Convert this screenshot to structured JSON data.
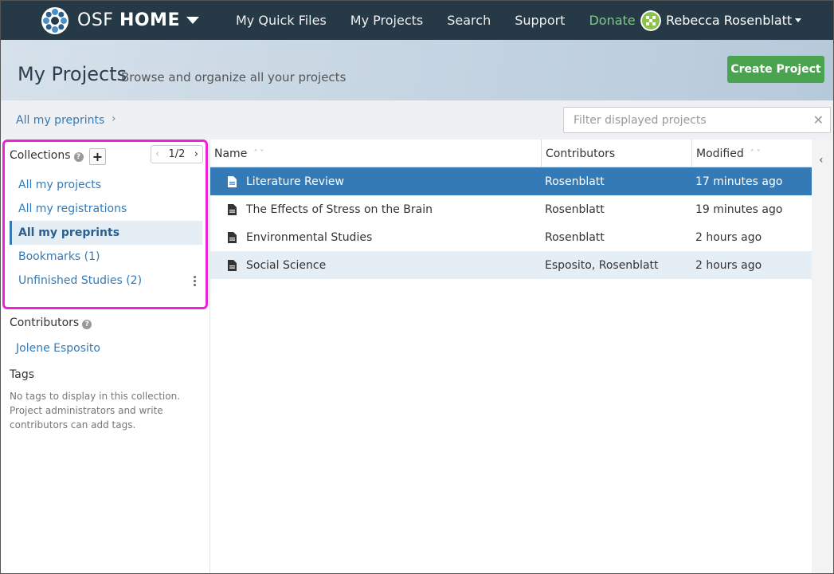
{
  "colors": {
    "navbar": "#263947",
    "accent": "#337ab7",
    "create": "#4aa34f",
    "highlight": "#ee22d6",
    "donate": "#7ec884"
  },
  "navbar": {
    "brand_prefix": "OSF",
    "brand_bold": "HOME",
    "links": [
      "My Quick Files",
      "My Projects",
      "Search",
      "Support",
      "Donate"
    ],
    "user": "Rebecca Rosenblatt"
  },
  "header": {
    "title": "My Projects",
    "subtitle": "Browse and organize all your projects",
    "create_label": "Create Project"
  },
  "breadcrumb": {
    "label": "All my preprints",
    "chevron": "›"
  },
  "filter": {
    "placeholder": "Filter displayed projects",
    "value": ""
  },
  "sidebar": {
    "collections_title": "Collections",
    "help": "?",
    "add": "+",
    "pager": {
      "prev": "‹",
      "label": "1/2",
      "next": "›"
    },
    "collections": [
      {
        "label": "All my projects"
      },
      {
        "label": "All my registrations"
      },
      {
        "label": "All my preprints"
      },
      {
        "label": "Bookmarks (1)"
      },
      {
        "label": "Unfinished Studies (2)"
      }
    ],
    "contributors_title": "Contributors",
    "contributors": [
      "Jolene Esposito"
    ],
    "tags_title": "Tags",
    "tags_empty": "No tags to display in this collection. Project administrators and write contributors can add tags."
  },
  "table": {
    "columns": {
      "name": "Name",
      "contributors": "Contributors",
      "modified": "Modified"
    },
    "sort_glyph": "˄˅",
    "rows": [
      {
        "name": "Literature Review",
        "contributors": "Rosenblatt",
        "modified": "17 minutes ago"
      },
      {
        "name": "The Effects of Stress on the Brain",
        "contributors": "Rosenblatt",
        "modified": "19 minutes ago"
      },
      {
        "name": "Environmental Studies",
        "contributors": "Rosenblatt",
        "modified": "2 hours ago"
      },
      {
        "name": "Social Science",
        "contributors": "Esposito, Rosenblatt",
        "modified": "2 hours ago"
      }
    ]
  },
  "collapse_arrow": "‹"
}
